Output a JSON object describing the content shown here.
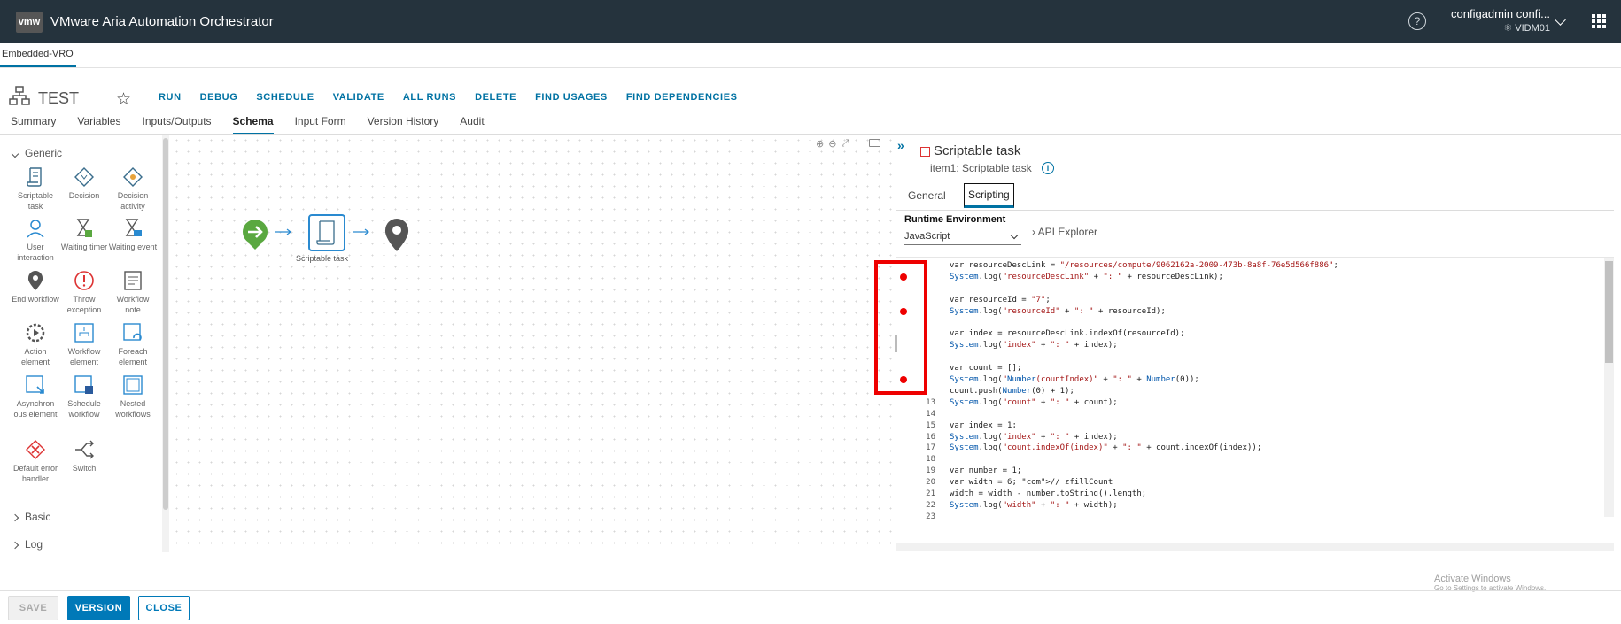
{
  "header": {
    "logo": "vmw",
    "title": "VMware Aria Automation Orchestrator",
    "user": "configadmin confi...",
    "tenant": "VIDM01",
    "help": "?"
  },
  "env_tab": "Embedded-VRO",
  "workflow": {
    "name": "TEST"
  },
  "actions": [
    "RUN",
    "DEBUG",
    "SCHEDULE",
    "VALIDATE",
    "ALL RUNS",
    "DELETE",
    "FIND USAGES",
    "FIND DEPENDENCIES"
  ],
  "tabs": [
    "Summary",
    "Variables",
    "Inputs/Outputs",
    "Schema",
    "Input Form",
    "Version History",
    "Audit"
  ],
  "palette": {
    "groups": [
      "Generic",
      "Basic",
      "Log"
    ],
    "items": [
      {
        "label": "Scriptable task",
        "icon": "scriptable-task-icon"
      },
      {
        "label": "Decision",
        "icon": "decision-icon"
      },
      {
        "label": "Decision activity",
        "icon": "decision-activity-icon"
      },
      {
        "label": "User interaction",
        "icon": "user-interaction-icon"
      },
      {
        "label": "Waiting timer",
        "icon": "waiting-timer-icon"
      },
      {
        "label": "Waiting event",
        "icon": "waiting-event-icon"
      },
      {
        "label": "End workflow",
        "icon": "end-workflow-icon"
      },
      {
        "label": "Throw exception",
        "icon": "throw-exception-icon"
      },
      {
        "label": "Workflow note",
        "icon": "workflow-note-icon"
      },
      {
        "label": "Action element",
        "icon": "action-element-icon"
      },
      {
        "label": "Workflow element",
        "icon": "workflow-element-icon"
      },
      {
        "label": "Foreach element",
        "icon": "foreach-element-icon"
      },
      {
        "label": "Asynchron ous element",
        "icon": "async-element-icon"
      },
      {
        "label": "Schedule workflow",
        "icon": "schedule-workflow-icon"
      },
      {
        "label": "Nested workflows",
        "icon": "nested-workflows-icon"
      },
      {
        "label": "Default error handler",
        "icon": "default-error-handler-icon"
      },
      {
        "label": "Switch",
        "icon": "switch-icon"
      }
    ]
  },
  "canvas": {
    "node_label": "Scriptable task"
  },
  "panel": {
    "title": "Scriptable task",
    "subtitle": "item1: Scriptable task",
    "tabs": [
      "General",
      "Scripting"
    ],
    "runtime_label": "Runtime Environment",
    "runtime_value": "JavaScript",
    "api_explorer": "API Explorer"
  },
  "code_lines": [
    {
      "n": "",
      "t": "var resourceDescLink = \"/resources/compute/9062162a-2009-473b-8a8f-76e5d566f886\";"
    },
    {
      "n": "",
      "t": "System.log(\"resourceDescLink\" + \": \" + resourceDescLink);"
    },
    {
      "n": "",
      "t": ""
    },
    {
      "n": "",
      "t": "var resourceId = \"7\";"
    },
    {
      "n": "",
      "t": "System.log(\"resourceId\" + \": \" + resourceId);"
    },
    {
      "n": "",
      "t": ""
    },
    {
      "n": "",
      "t": "var index = resourceDescLink.indexOf(resourceId);"
    },
    {
      "n": "",
      "t": "System.log(\"index\" + \": \" + index);"
    },
    {
      "n": "",
      "t": ""
    },
    {
      "n": "",
      "t": "var count = [];"
    },
    {
      "n": "",
      "t": "System.log(\"Number(countIndex)\" + \": \" + Number(0));"
    },
    {
      "n": "",
      "t": "count.push(Number(0) + 1);"
    },
    {
      "n": "13",
      "t": "System.log(\"count\" + \": \" + count);"
    },
    {
      "n": "14",
      "t": ""
    },
    {
      "n": "15",
      "t": "var index = 1;"
    },
    {
      "n": "16",
      "t": "System.log(\"index\" + \": \" + index);"
    },
    {
      "n": "17",
      "t": "System.log(\"count.indexOf(index)\" + \": \" + count.indexOf(index));"
    },
    {
      "n": "18",
      "t": ""
    },
    {
      "n": "19",
      "t": "var number = 1;"
    },
    {
      "n": "20",
      "t": "var width = 6; // zfillCount"
    },
    {
      "n": "21",
      "t": "width = width - number.toString().length;"
    },
    {
      "n": "22",
      "t": "System.log(\"width\" + \": \" + width);"
    },
    {
      "n": "23",
      "t": ""
    }
  ],
  "breakpoint_rows": [
    1,
    4,
    10
  ],
  "watermark": {
    "line1": "Activate Windows",
    "line2": "Go to Settings to activate Windows."
  },
  "footer": {
    "save": "SAVE",
    "version": "VERSION",
    "close": "CLOSE"
  },
  "colors": {
    "header_bg": "#25333d",
    "accent": "#0072a3",
    "breakpoint": "#ee0000"
  }
}
